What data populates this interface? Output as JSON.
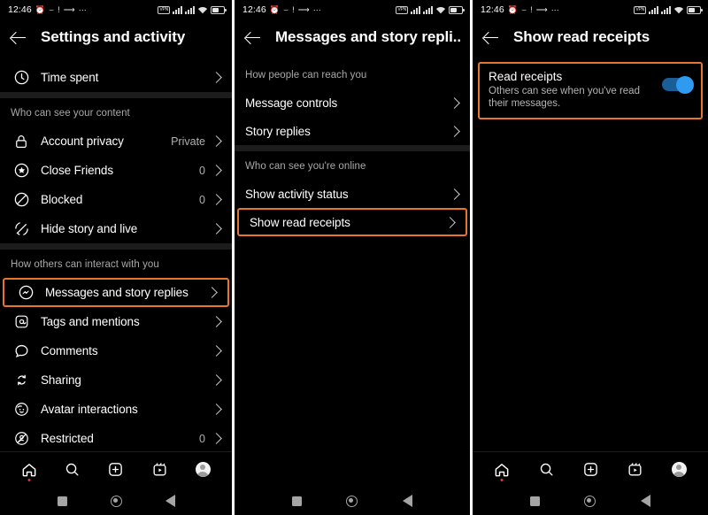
{
  "status_bar": {
    "time": "12:46",
    "left_icons": [
      "alarm-icon",
      "call-forward-icon",
      "alert-icon",
      "data-icon",
      "more-dots-icon"
    ],
    "right_icons": [
      "vpn-icon",
      "signal-1-icon",
      "signal-2-icon",
      "wifi-icon",
      "battery-icon"
    ],
    "vpn_label": "VPN"
  },
  "panel1": {
    "title": "Settings and activity",
    "partial_row": "",
    "rows_top": [
      {
        "icon": "clock-icon",
        "label": "Time spent",
        "value": "",
        "chevron": true
      }
    ],
    "section1_label": "Who can see your content",
    "rows_section1": [
      {
        "icon": "lock-icon",
        "label": "Account privacy",
        "value": "Private",
        "chevron": true
      },
      {
        "icon": "star-circle-icon",
        "label": "Close Friends",
        "value": "0",
        "chevron": true
      },
      {
        "icon": "blocked-icon",
        "label": "Blocked",
        "value": "0",
        "chevron": true
      },
      {
        "icon": "hide-story-icon",
        "label": "Hide story and live",
        "value": "",
        "chevron": true
      }
    ],
    "section2_label": "How others can interact with you",
    "rows_section2": [
      {
        "icon": "messenger-icon",
        "label": "Messages and story replies",
        "value": "",
        "chevron": true,
        "highlighted": true
      },
      {
        "icon": "at-mention-icon",
        "label": "Tags and mentions",
        "value": "",
        "chevron": true
      },
      {
        "icon": "comment-icon",
        "label": "Comments",
        "value": "",
        "chevron": true
      },
      {
        "icon": "share-icon",
        "label": "Sharing",
        "value": "",
        "chevron": true
      },
      {
        "icon": "avatar-face-icon",
        "label": "Avatar interactions",
        "value": "",
        "chevron": true
      },
      {
        "icon": "restricted-icon",
        "label": "Restricted",
        "value": "0",
        "chevron": true
      }
    ],
    "tabbar": [
      "home-icon",
      "search-icon",
      "create-icon",
      "reels-icon",
      "profile-avatar"
    ]
  },
  "panel2": {
    "title": "Messages and story repli...",
    "section1_label": "How people can reach you",
    "rows_section1": [
      {
        "label": "Message controls",
        "chevron": true
      },
      {
        "label": "Story replies",
        "chevron": true
      }
    ],
    "section2_label": "Who can see you're online",
    "rows_section2": [
      {
        "label": "Show activity status",
        "chevron": true
      },
      {
        "label": "Show read receipts",
        "chevron": true,
        "highlighted": true
      }
    ]
  },
  "panel3": {
    "title": "Show read receipts",
    "toggle": {
      "title": "Read receipts",
      "subtitle": "Others can see when you've read their messages.",
      "state": "on",
      "highlighted": true
    },
    "tabbar": [
      "home-icon",
      "search-icon",
      "create-icon",
      "reels-icon",
      "profile-avatar"
    ]
  },
  "android_nav": [
    "recents-square-icon",
    "home-circle-icon",
    "back-triangle-icon"
  ],
  "colors": {
    "background": "#000000",
    "highlight": "#e5762b",
    "toggle_on": "#2e9bf0",
    "section_label": "#a8a8a8",
    "notification_dot": "#e3353f"
  }
}
